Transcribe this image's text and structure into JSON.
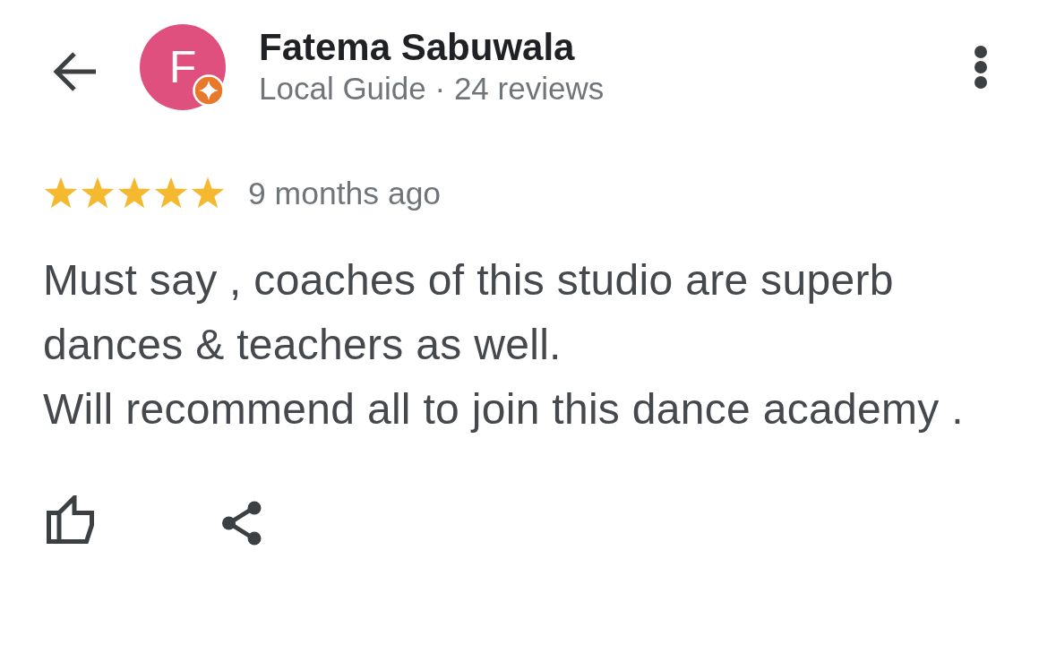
{
  "reviewer": {
    "initial": "F",
    "name": "Fatema Sabuwala",
    "subtitle": "Local Guide · 24 reviews"
  },
  "review": {
    "stars": 5,
    "time": "9 months ago",
    "text": "Must say , coaches of this studio are superb dances & teachers as well.\nWill recommend all to join this dance academy ."
  }
}
